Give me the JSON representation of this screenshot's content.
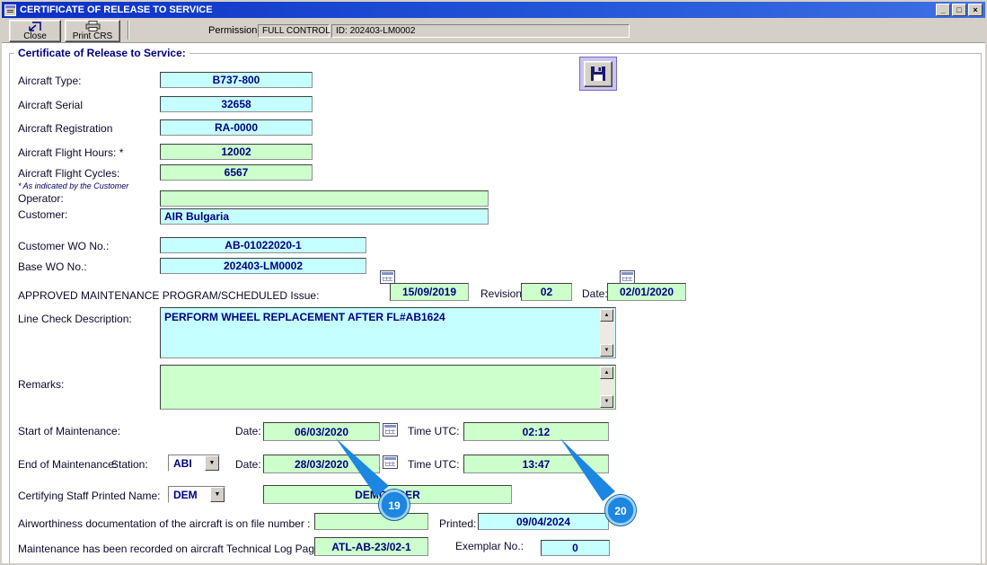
{
  "window": {
    "title": "CERTIFICATE OF RELEASE TO SERVICE",
    "controls": {
      "minimize": "_",
      "maximize": "□",
      "close": "×"
    }
  },
  "toolbar": {
    "close_label": "Close",
    "print_label": "Print CRS",
    "permission_label": "Permission:",
    "permission_value": "FULL CONTROL",
    "id_label": "ID:",
    "id_value": "202403-LM0002"
  },
  "form": {
    "group_title": "Certificate of Release to Service:",
    "aircraft_type": {
      "label": "Aircraft Type:",
      "value": "B737-800"
    },
    "aircraft_serial": {
      "label": "Aircraft Serial",
      "value": "32658"
    },
    "aircraft_registration": {
      "label": "Aircraft Registration",
      "value": "RA-0000"
    },
    "flight_hours": {
      "label": "Aircraft Flight Hours: *",
      "value": "12002"
    },
    "flight_cycles": {
      "label": "Aircraft Flight Cycles:",
      "value": "6567"
    },
    "footnote": "* As indicated by the Customer",
    "operator": {
      "label": "Operator:",
      "value": ""
    },
    "customer": {
      "label": "Customer:",
      "value": "AIR Bulgaria"
    },
    "customer_wo": {
      "label": "Customer WO No.:",
      "value": "AB-01022020-1"
    },
    "base_wo": {
      "label": "Base WO No.:",
      "value": "202403-LM0002"
    },
    "amp": {
      "label": "APPROVED MAINTENANCE PROGRAM/SCHEDULED Issue:",
      "issue_value": "15/09/2019",
      "revision_label": "Revision:",
      "revision_value": "02",
      "date_label": "Date:",
      "date_value": "02/01/2020"
    },
    "line_check": {
      "label": "Line Check Description:",
      "value": "PERFORM WHEEL REPLACEMENT AFTER FL#AB1624"
    },
    "remarks": {
      "label": "Remarks:",
      "value": ""
    },
    "start_maintenance": {
      "label": "Start of Maintenance:",
      "date_label": "Date:",
      "date_value": "06/03/2020",
      "time_label": "Time UTC:",
      "time_value": "02:12"
    },
    "end_maintenance": {
      "label": "End of Maintenance:",
      "station_label": "Station:",
      "station_value": "ABI",
      "date_label": "Date:",
      "date_value": "28/03/2020",
      "time_label": "Time UTC:",
      "time_value": "13:47"
    },
    "certifying": {
      "label": "Certifying Staff Printed Name:",
      "code_value": "DEM",
      "name_value": "DEMO USER"
    },
    "airworthiness": {
      "label": "Airworthiness documentation of the aircraft is on file number :",
      "file_value": "",
      "printed_label": "Printed:",
      "printed_value": "09/04/2024"
    },
    "tech_log": {
      "label": "Maintenance has been recorded on aircraft Technical Log Page:",
      "value": "ATL-AB-23/02-1",
      "exemplar_label": "Exemplar No.:",
      "exemplar_value": "0"
    }
  },
  "callouts": [
    {
      "number": "19"
    },
    {
      "number": "20"
    }
  ],
  "icons": {
    "dropdown_arrow": "▼",
    "scroll_up": "▲",
    "scroll_down": "▼"
  },
  "colors": {
    "cyan_field": "#c6ffff",
    "green_field": "#ccffcc",
    "value_text": "#000080",
    "callout_blue": "#1c86e0",
    "titlebar_blue": "#0c2fc4"
  }
}
